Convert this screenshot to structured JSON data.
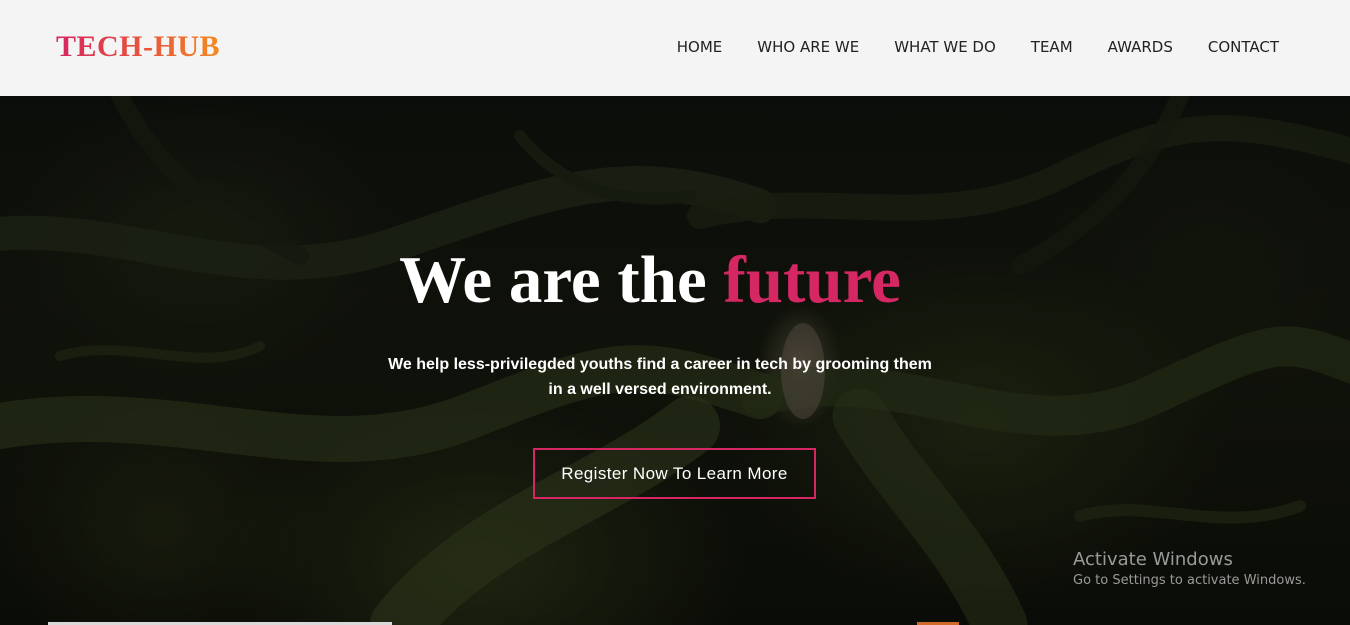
{
  "brand": {
    "name": "TECH-HUB"
  },
  "nav": {
    "items": [
      {
        "label": "HOME"
      },
      {
        "label": "WHO ARE WE"
      },
      {
        "label": "WHAT WE DO"
      },
      {
        "label": "TEAM"
      },
      {
        "label": "AWARDS"
      },
      {
        "label": "CONTACT"
      }
    ]
  },
  "hero": {
    "title_main": "We are the",
    "title_accent": "future",
    "subtitle": "We help less-privilegded youths find a career in tech by grooming them in a well versed environment.",
    "cta_label": "Register Now To Learn More"
  },
  "windows_watermark": {
    "title": "Activate Windows",
    "subtitle": "Go to Settings to activate Windows."
  },
  "colors": {
    "accent": "#d42763",
    "logo_gradient_start": "#d6265f",
    "logo_gradient_end": "#f48a1f",
    "navbar_bg": "#f4f4f4"
  }
}
